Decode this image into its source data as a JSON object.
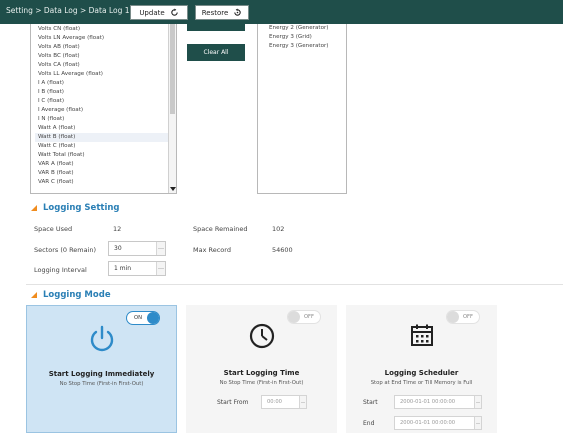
{
  "header": {
    "breadcrumb": "Setting > Data Log > Data Log 1",
    "update_label": "Update",
    "restore_label": "Restore"
  },
  "field_list": {
    "items": [
      "Volts CN (float)",
      "Volts LN Average (float)",
      "Volts AB (float)",
      "Volts BC (float)",
      "Volts CA (float)",
      "Volts LL Average (float)",
      "I A (float)",
      "I B (float)",
      "I C (float)",
      "I Average (float)",
      "I N (float)",
      "Watt A (float)",
      "Watt B (float)",
      "Watt C (float)",
      "Watt Total (float)",
      "VAR A (float)",
      "VAR B (float)",
      "VAR C (float)"
    ],
    "selected_index": 12
  },
  "buttons": {
    "clear_all_label": "Clear All"
  },
  "selected_list": {
    "items": [
      "Energy 2 (Generator)",
      "Energy 3 (Grid)",
      "Energy 3 (Generator)"
    ]
  },
  "logging_setting": {
    "title": "Logging Setting",
    "space_used_label": "Space Used",
    "space_used_value": "12",
    "sectors_label": "Sectors (0 Remain)",
    "sectors_value": "30",
    "interval_label": "Logging Interval",
    "interval_value": "1 min",
    "space_remained_label": "Space Remained",
    "space_remained_value": "102",
    "max_record_label": "Max Record",
    "max_record_value": "54600"
  },
  "logging_mode": {
    "title": "Logging Mode",
    "cards": [
      {
        "icon": "power-icon",
        "toggle_label": "ON",
        "toggle_state": "on",
        "title": "Start Logging Immediately",
        "subtitle": "No Stop Time (First-in First-Out)"
      },
      {
        "icon": "clock-icon",
        "toggle_label": "OFF",
        "toggle_state": "off",
        "title": "Start Logging Time",
        "subtitle": "No Stop Time (First-in First-Out)",
        "start_from_label": "Start From",
        "start_from_value": "00:00"
      },
      {
        "icon": "calendar-icon",
        "toggle_label": "OFF",
        "toggle_state": "off",
        "title": "Logging Scheduler",
        "subtitle": "Stop at End Time or Till Memory is Full",
        "start_label": "Start",
        "start_value": "2000-01-01 00:00:00",
        "end_label": "End",
        "end_value": "2000-01-01 00:00:00"
      }
    ]
  },
  "colors": {
    "header_bg": "#1f4e4a",
    "accent_blue": "#2a7fb5",
    "section_marker": "#f08c1e",
    "toggle_on": "#2e8bc9",
    "active_card_bg": "#cfe4f4"
  }
}
